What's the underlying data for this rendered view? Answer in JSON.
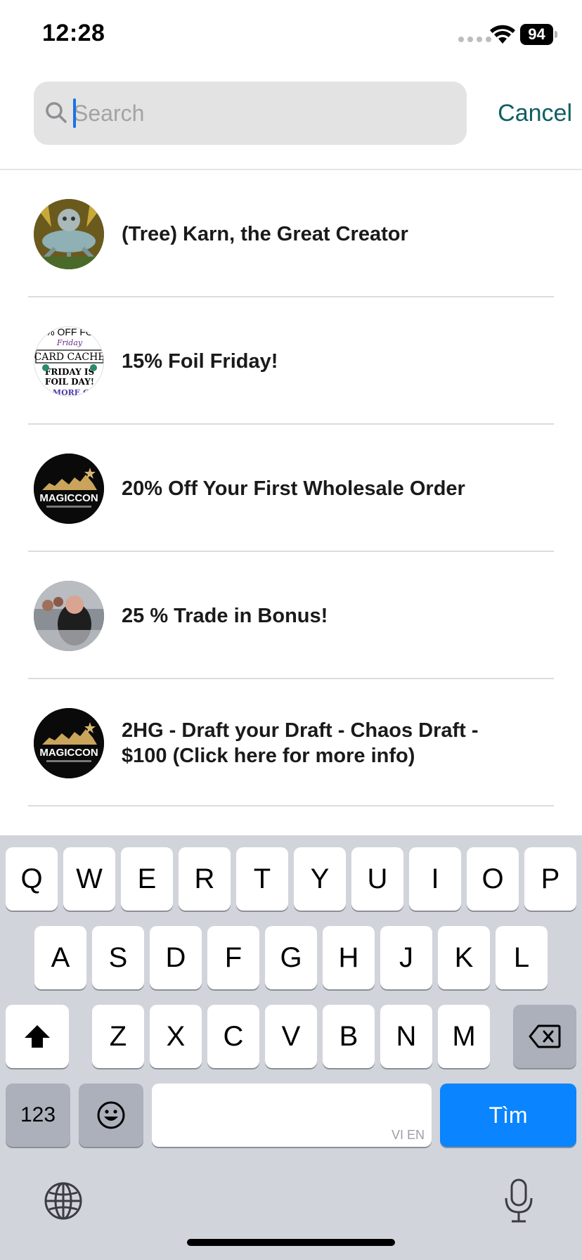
{
  "status_bar": {
    "time": "12:28",
    "battery": "94"
  },
  "search": {
    "placeholder": "Search",
    "cancel_label": "Cancel"
  },
  "results": [
    {
      "title": "(Tree) Karn, the Great Creator",
      "avatar": "karn-artwork"
    },
    {
      "title": "15% Foil Friday!",
      "avatar": "foil-friday-flyer",
      "avatar_text": [
        "% OFF FO",
        "Friday",
        "CARD CACHE",
        "FRIDAY IS",
        "FOIL DAY!",
        "E MORE CA"
      ]
    },
    {
      "title": "20% Off Your First Wholesale Order",
      "avatar": "magiccon-logo",
      "avatar_text": "MAGICCON"
    },
    {
      "title": "25 % Trade in Bonus!",
      "avatar": "person-photo"
    },
    {
      "title": "2HG - Draft your Draft - Chaos Draft - $100 (Click here for more info)",
      "avatar": "magiccon-logo",
      "avatar_text": "MAGICCON"
    }
  ],
  "keyboard": {
    "row1": [
      "Q",
      "W",
      "E",
      "R",
      "T",
      "Y",
      "U",
      "I",
      "O",
      "P"
    ],
    "row2": [
      "A",
      "S",
      "D",
      "F",
      "G",
      "H",
      "J",
      "K",
      "L"
    ],
    "row3": [
      "Z",
      "X",
      "C",
      "V",
      "B",
      "N",
      "M"
    ],
    "numbers_label": "123",
    "space_hint": "VI EN",
    "return_label": "Tìm"
  },
  "colors": {
    "accent": "#0e5f63",
    "keyboard_blue": "#0a84ff",
    "keyboard_bg": "#d1d4db"
  }
}
